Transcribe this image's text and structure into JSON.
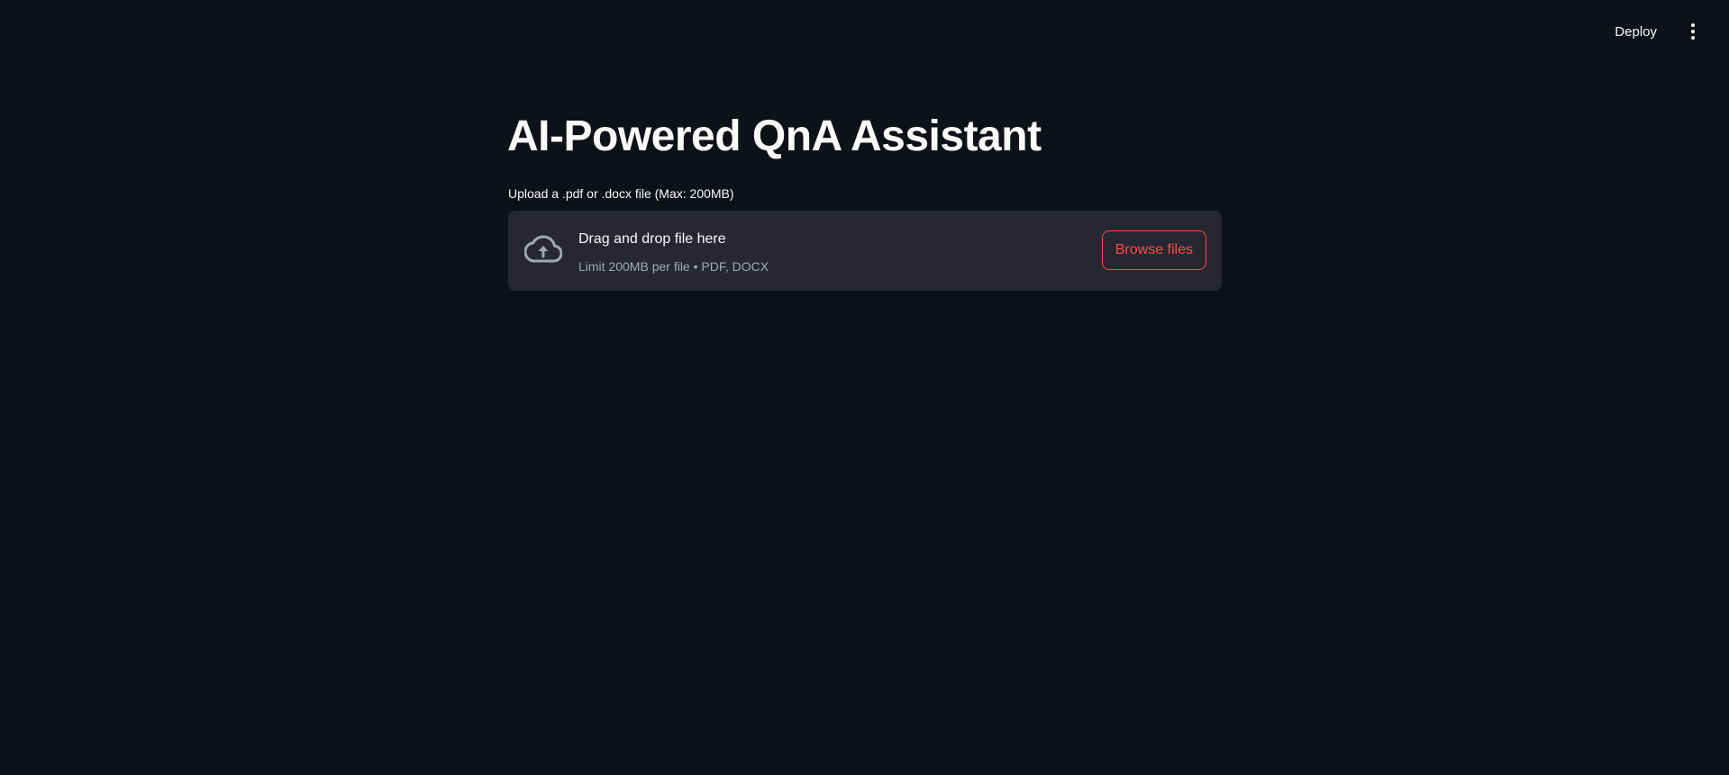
{
  "header": {
    "deploy_label": "Deploy",
    "menu_icon": "more-vertical-icon"
  },
  "main": {
    "title": "AI-Powered QnA Assistant",
    "uploader": {
      "label": "Upload a .pdf or .docx file (Max: 200MB)",
      "dropzone_icon": "cloud-upload-icon",
      "dropzone_title": "Drag and drop file here",
      "dropzone_subtitle": "Limit 200MB per file • PDF, DOCX",
      "browse_label": "Browse files"
    }
  },
  "colors": {
    "background": "#0e1117",
    "dropzone_bg": "#262730",
    "accent": "#ff4b4b",
    "text": "#fafafa",
    "muted_text": "#a3a8b4"
  }
}
